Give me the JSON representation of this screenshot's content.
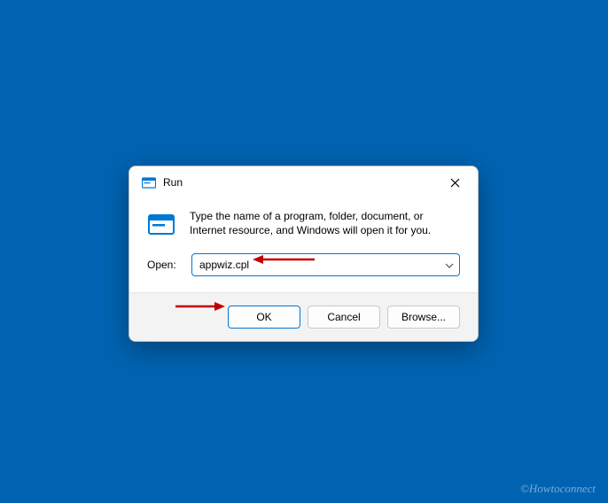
{
  "dialog": {
    "title": "Run",
    "description": "Type the name of a program, folder, document, or Internet resource, and Windows will open it for you.",
    "open_label": "Open:",
    "input_value": "appwiz.cpl",
    "buttons": {
      "ok": "OK",
      "cancel": "Cancel",
      "browse": "Browse..."
    }
  },
  "watermark": "©Howtoconnect",
  "colors": {
    "desktop": "#0063b1",
    "accent": "#0078d4",
    "annotation": "#c00000"
  }
}
